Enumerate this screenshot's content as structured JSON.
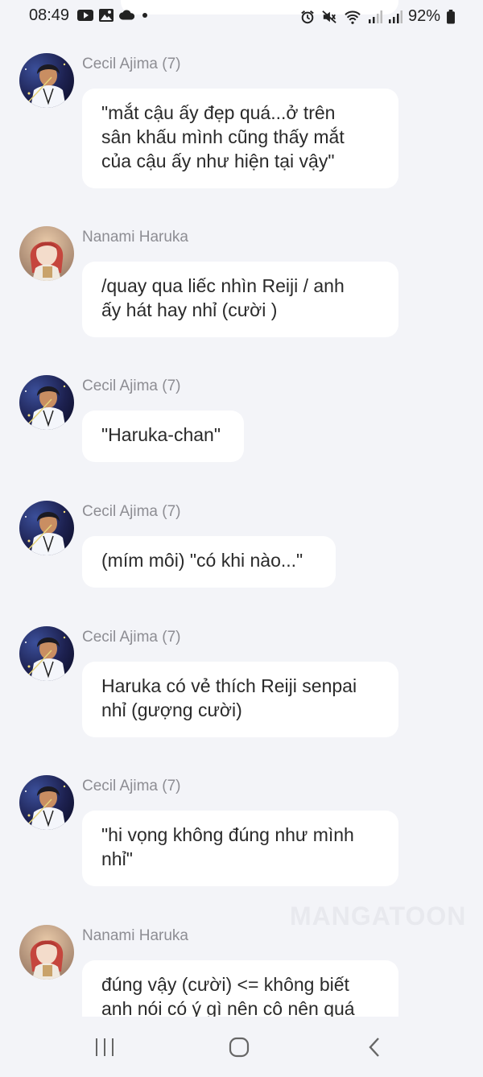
{
  "status_bar": {
    "time": "08:49",
    "battery": "92%"
  },
  "messages": [
    {
      "sender": "Cecil Ajima (7)",
      "avatar": "cecil-avatar",
      "text": "\"mắt cậu ấy đẹp quá...ở trên\nsân khấu mình cũng thấy mắt\ncủa cậu ấy như hiện tại vậy\""
    },
    {
      "sender": "Nanami Haruka",
      "avatar": "haruka-avatar",
      "text": "/quay qua liếc nhìn Reiji / anh\nấy hát hay nhỉ (cười )"
    },
    {
      "sender": "Cecil Ajima (7)",
      "avatar": "cecil-avatar",
      "text": "\"Haruka-chan\""
    },
    {
      "sender": "Cecil Ajima (7)",
      "avatar": "cecil-avatar",
      "text": "(mím môi) \"có khi nào...\""
    },
    {
      "sender": "Cecil Ajima (7)",
      "avatar": "cecil-avatar",
      "text": "Haruka có vẻ thích Reiji senpai\nnhỉ (gượng cười)"
    },
    {
      "sender": "Cecil Ajima (7)",
      "avatar": "cecil-avatar",
      "text": "\"hi vọng không đúng như mình\nnhỉ\""
    },
    {
      "sender": "Nanami Haruka",
      "avatar": "haruka-avatar",
      "text": "đúng vậy (cười) <= không biết\nanh nói có ý gì nên cô nên quá"
    }
  ],
  "watermark": "MANGATOON",
  "nav": {
    "recent_icon": "recent-apps-icon",
    "home_icon": "home-icon",
    "back_icon": "back-icon"
  }
}
